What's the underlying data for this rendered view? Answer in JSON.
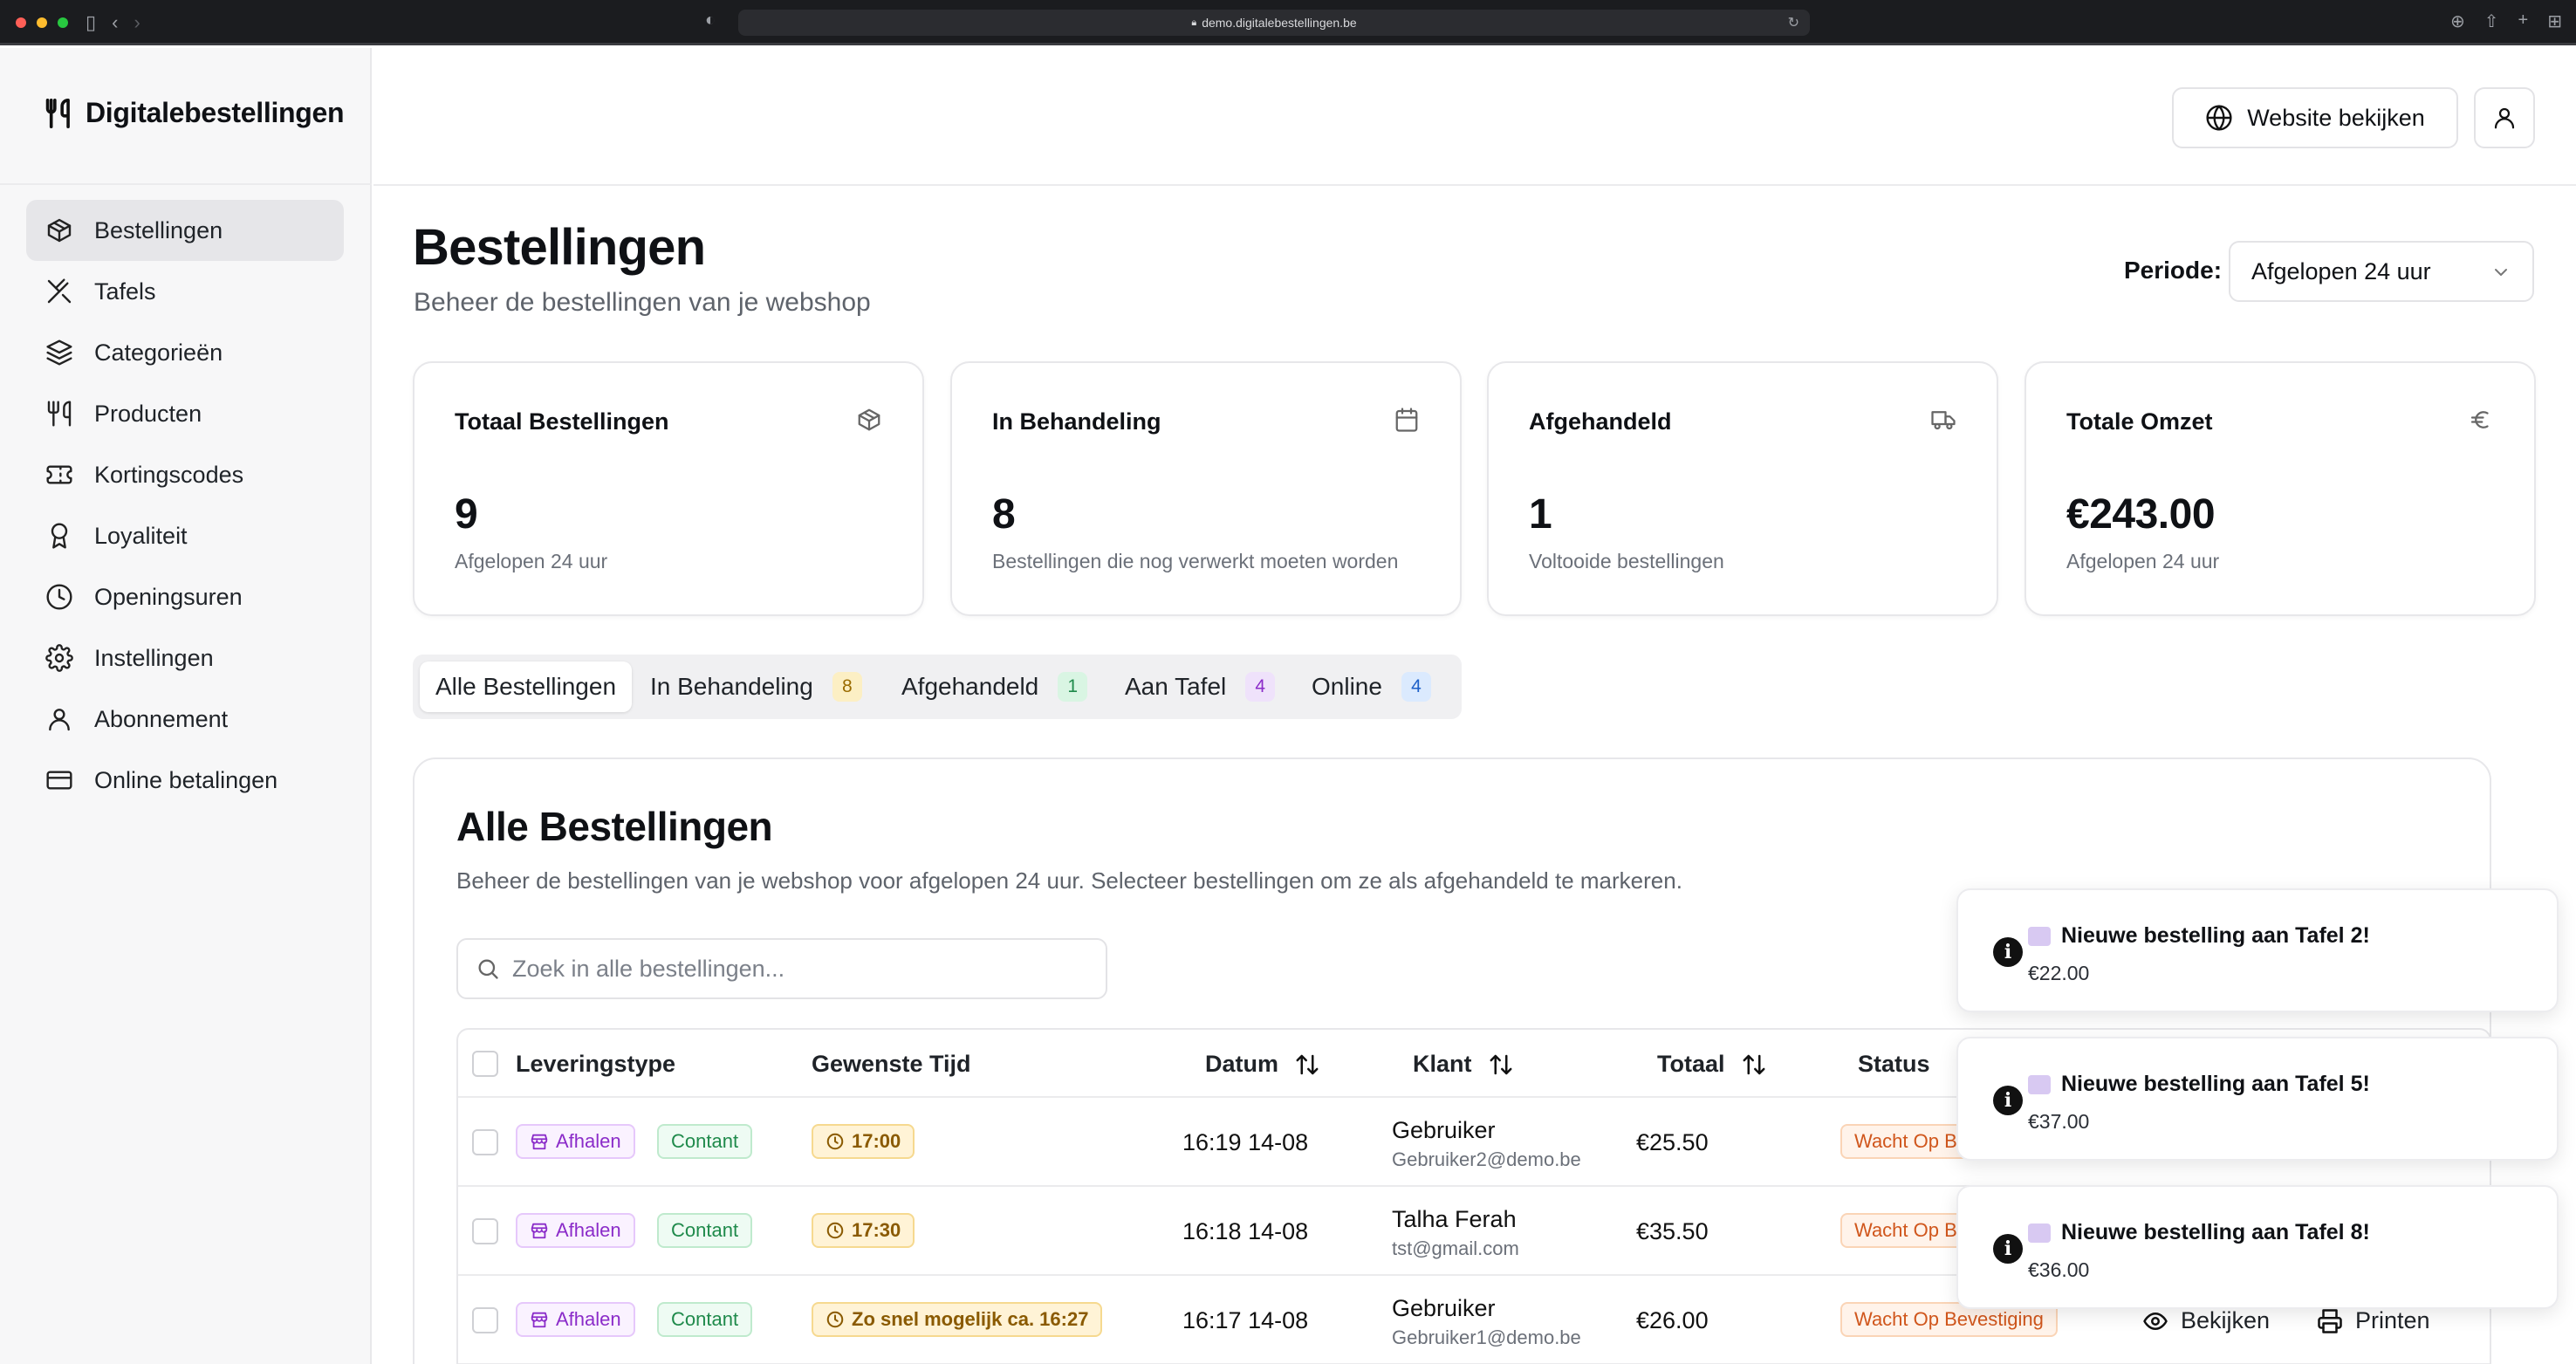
{
  "browser": {
    "url": "demo.digitalebestellingen.be"
  },
  "brand": {
    "name": "Digitalebestellingen"
  },
  "sidebar": {
    "items": [
      {
        "label": "Bestellingen",
        "icon": "package-icon",
        "active": true
      },
      {
        "label": "Tafels",
        "icon": "utensils-crossed-icon",
        "active": false
      },
      {
        "label": "Categorieën",
        "icon": "layers-icon",
        "active": false
      },
      {
        "label": "Producten",
        "icon": "utensils-icon",
        "active": false
      },
      {
        "label": "Kortingscodes",
        "icon": "ticket-icon",
        "active": false
      },
      {
        "label": "Loyaliteit",
        "icon": "award-icon",
        "active": false
      },
      {
        "label": "Openingsuren",
        "icon": "clock-icon",
        "active": false
      },
      {
        "label": "Instellingen",
        "icon": "gear-icon",
        "active": false
      },
      {
        "label": "Abonnement",
        "icon": "user-icon",
        "active": false
      },
      {
        "label": "Online betalingen",
        "icon": "credit-card-icon",
        "active": false
      }
    ]
  },
  "header": {
    "website_button": "Website bekijken"
  },
  "page": {
    "title": "Bestellingen",
    "subtitle": "Beheer de bestellingen van je webshop",
    "periode_label": "Periode:",
    "periode_value": "Afgelopen 24 uur"
  },
  "stats": [
    {
      "title": "Totaal Bestellingen",
      "value": "9",
      "sub": "Afgelopen 24 uur",
      "icon": "package-icon"
    },
    {
      "title": "In Behandeling",
      "value": "8",
      "sub": "Bestellingen die nog verwerkt moeten worden",
      "icon": "calendar-icon"
    },
    {
      "title": "Afgehandeld",
      "value": "1",
      "sub": "Voltooide bestellingen",
      "icon": "truck-icon"
    },
    {
      "title": "Totale Omzet",
      "value": "€243.00",
      "sub": "Afgelopen 24 uur",
      "icon": "euro-icon"
    }
  ],
  "tabs": [
    {
      "label": "Alle Bestellingen",
      "count": ""
    },
    {
      "label": "In Behandeling",
      "count": "8"
    },
    {
      "label": "Afgehandeld",
      "count": "1"
    },
    {
      "label": "Aan Tafel",
      "count": "4"
    },
    {
      "label": "Online",
      "count": "4"
    }
  ],
  "colors": {
    "badge_pending_bg": "#fcefc4",
    "badge_pending_fg": "#9a6b00",
    "badge_done_bg": "#d9f5e3",
    "badge_done_fg": "#1f8a4b",
    "badge_table_bg": "#efe2fb",
    "badge_table_fg": "#8b2cc9",
    "badge_online_bg": "#dbeafe",
    "badge_online_fg": "#1d5fc8"
  },
  "orders": {
    "title": "Alle Bestellingen",
    "description": "Beheer de bestellingen van je webshop voor afgelopen 24 uur. Selecteer bestellingen om ze als afgehandeld te markeren.",
    "search_placeholder": "Zoek in alle bestellingen...",
    "columns": {
      "leveringstype": "Leveringstype",
      "gewenste_tijd": "Gewenste Tijd",
      "datum": "Datum",
      "klant": "Klant",
      "totaal": "Totaal",
      "status": "Status"
    },
    "rows": [
      {
        "type": "Afhalen",
        "payment": "Contant",
        "time": "17:00",
        "date": "16:19 14-08",
        "customer": "Gebruiker",
        "email": "Gebruiker2@demo.be",
        "total": "€25.50",
        "status": "Wacht Op Bevestiging"
      },
      {
        "type": "Afhalen",
        "payment": "Contant",
        "time": "17:30",
        "date": "16:18 14-08",
        "customer": "Talha Ferah",
        "email": "tst@gmail.com",
        "total": "€35.50",
        "status": "Wacht Op Bevestiging"
      },
      {
        "type": "Afhalen",
        "payment": "Contant",
        "time": "Zo snel mogelijk ca. 16:27",
        "date": "16:17 14-08",
        "customer": "Gebruiker",
        "email": "Gebruiker1@demo.be",
        "total": "€26.00",
        "status": "Wacht Op Bevestiging"
      }
    ],
    "actions": {
      "view": "Bekijken",
      "print": "Printen"
    }
  },
  "toasts": [
    {
      "title": "Nieuwe bestelling aan Tafel 2!",
      "amount": "€22.00"
    },
    {
      "title": "Nieuwe bestelling aan Tafel 5!",
      "amount": "€37.00"
    },
    {
      "title": "Nieuwe bestelling aan Tafel 8!",
      "amount": "€36.00"
    }
  ]
}
